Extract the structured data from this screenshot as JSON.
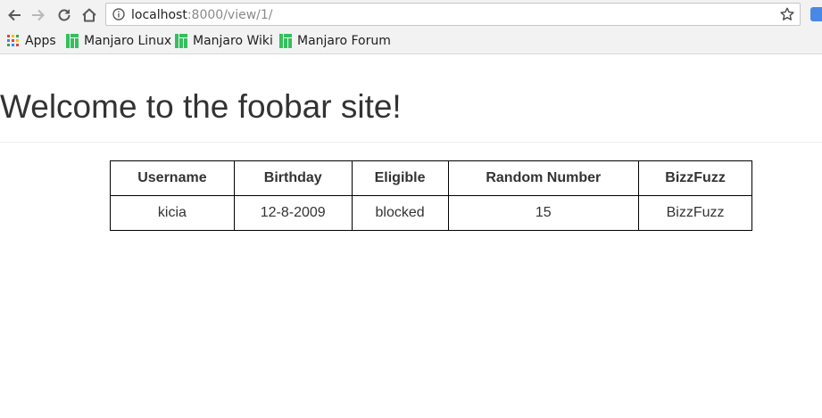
{
  "browser": {
    "url_host": "localhost",
    "url_rest": ":8000/view/1/"
  },
  "bookmarks": [
    {
      "label": "Apps"
    },
    {
      "label": "Manjaro Linux"
    },
    {
      "label": "Manjaro Wiki"
    },
    {
      "label": "Manjaro Forum"
    }
  ],
  "page": {
    "title": "Welcome to the foobar site!"
  },
  "table": {
    "headers": [
      "Username",
      "Birthday",
      "Eligible",
      "Random Number",
      "BizzFuzz"
    ],
    "rows": [
      [
        "kicia",
        "12-8-2009",
        "blocked",
        "15",
        "BizzFuzz"
      ]
    ]
  },
  "colors": {
    "manjaro_green": "#35bf5c",
    "text": "#333333"
  }
}
